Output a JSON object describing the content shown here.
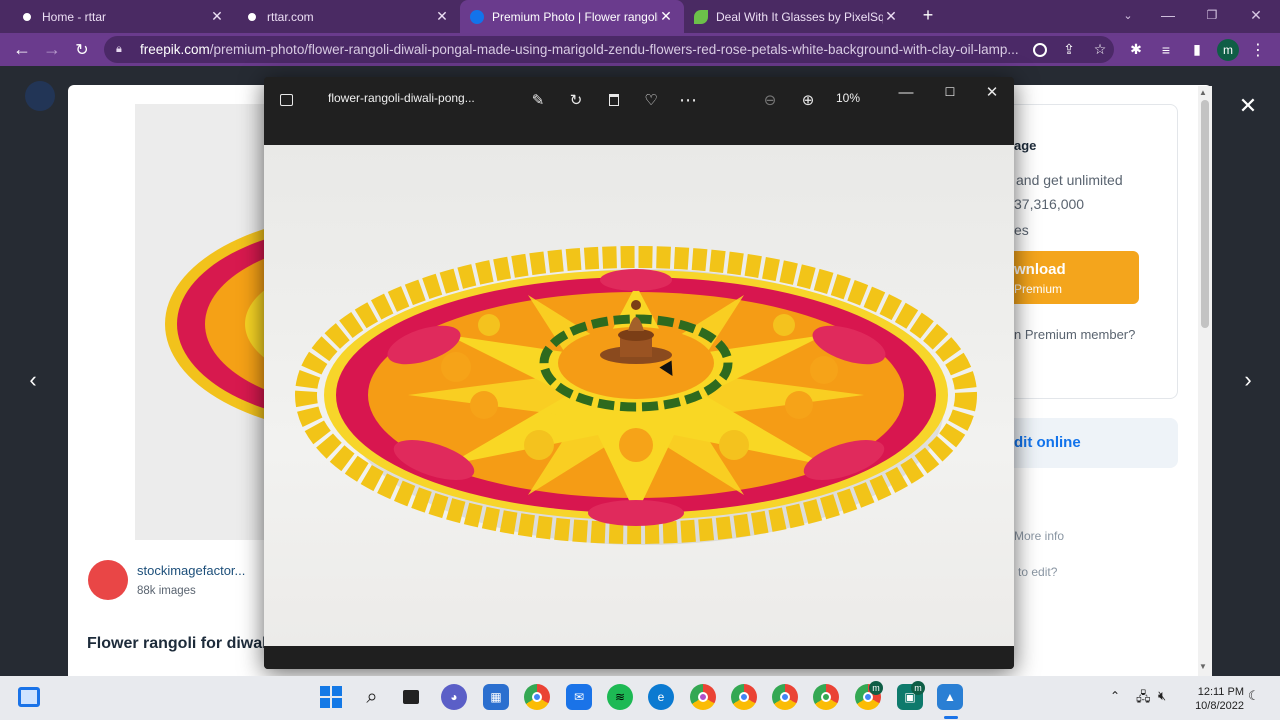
{
  "browser": {
    "tabs": [
      {
        "title": "Home - rttar",
        "favicon_color": "#ffffff",
        "active": false
      },
      {
        "title": "rttar.com",
        "favicon_color": "#ffffff",
        "active": false
      },
      {
        "title": "Premium Photo | Flower rangoli f",
        "favicon_color": "#1273eb",
        "active": true
      },
      {
        "title": "Deal With It Glasses by PixelSqui",
        "favicon_color": "#6cc04a",
        "active": false
      }
    ],
    "new_tab": "+",
    "url_domain": "freepik.com",
    "url_path": "/premium-photo/flower-rangoli-diwali-pongal-made-using-marigold-zendu-flowers-red-rose-petals-white-background-with-clay-oil-lamp...",
    "profile_initial": "m"
  },
  "freepik_page": {
    "author_name": "stockimagefactor...",
    "author_images": "88k images",
    "photo_title_partial": "Flower rangoli for diwal",
    "side_heading_partial": "age",
    "side_line1": "and get unlimited",
    "side_line2": "37,316,000",
    "side_line3": "es",
    "download_label": "wnload",
    "download_sub": "Premium",
    "member_text": "n Premium member?",
    "edit_online": "dit online",
    "more_info": "More info",
    "how_to_edit": "to edit?"
  },
  "photos_viewer": {
    "filename": "flower-rangoli-diwali-pong...",
    "zoom": "10%"
  },
  "taskbar": {
    "time": "12:11 PM",
    "date": "10/8/2022",
    "badge_initial": "m"
  },
  "colors": {
    "tab_strip": "#4a2a63",
    "toolbar": "#6a3b8d",
    "download_button": "#f4a51c",
    "link_blue": "#1273eb"
  }
}
